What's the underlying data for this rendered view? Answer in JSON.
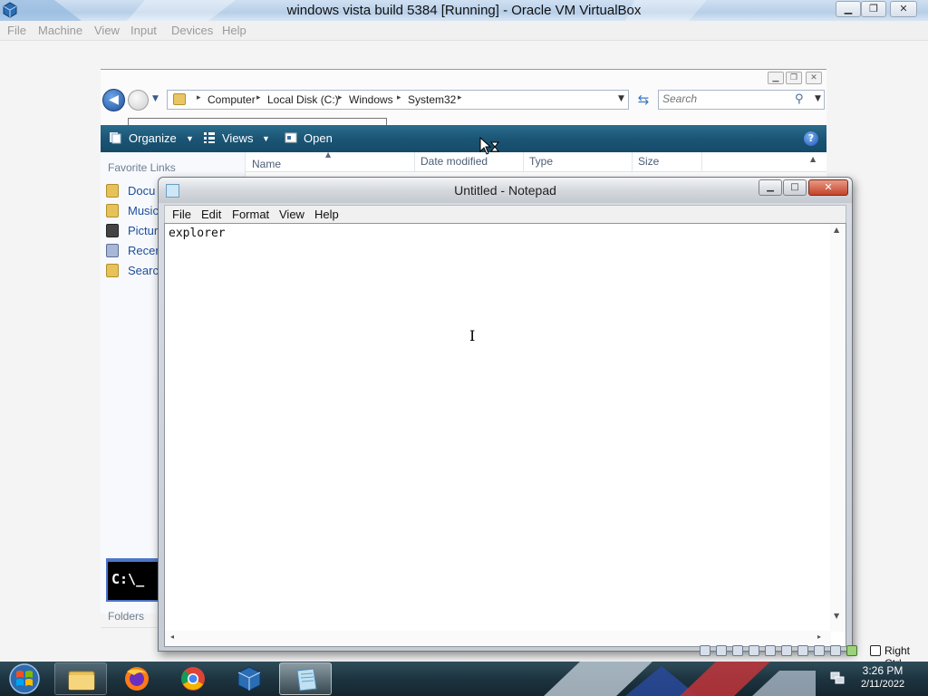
{
  "host": {
    "title": "windows vista build 5384 [Running] - Oracle VM VirtualBox",
    "menu": [
      "File",
      "Machine",
      "View",
      "Input",
      "Devices",
      "Help"
    ],
    "host_key": "Right Ctrl"
  },
  "explorer": {
    "breadcrumb": [
      "Computer",
      "Local Disk (C:)",
      "Windows",
      "System32"
    ],
    "search_placeholder": "Search",
    "toolbar": {
      "organize": "Organize",
      "views": "Views",
      "open": "Open"
    },
    "favorites_heading": "Favorite Links",
    "favorites": [
      "Docu",
      "Music",
      "Pictur",
      "Recen",
      "Search"
    ],
    "folders_heading": "Folders",
    "columns": [
      "Name",
      "Date modified",
      "Type",
      "Size"
    ]
  },
  "notepad": {
    "title": "Untitled - Notepad",
    "menu": [
      "File",
      "Edit",
      "Format",
      "View",
      "Help"
    ],
    "content": "explorer"
  },
  "cmd_thumbnail": "C:\\_",
  "taskbar": {
    "apps": [
      "file-explorer-icon",
      "firefox-icon",
      "chrome-icon",
      "virtualbox-icon",
      "notepad-icon"
    ],
    "time": "3:26 PM",
    "date": "2/11/2022"
  }
}
